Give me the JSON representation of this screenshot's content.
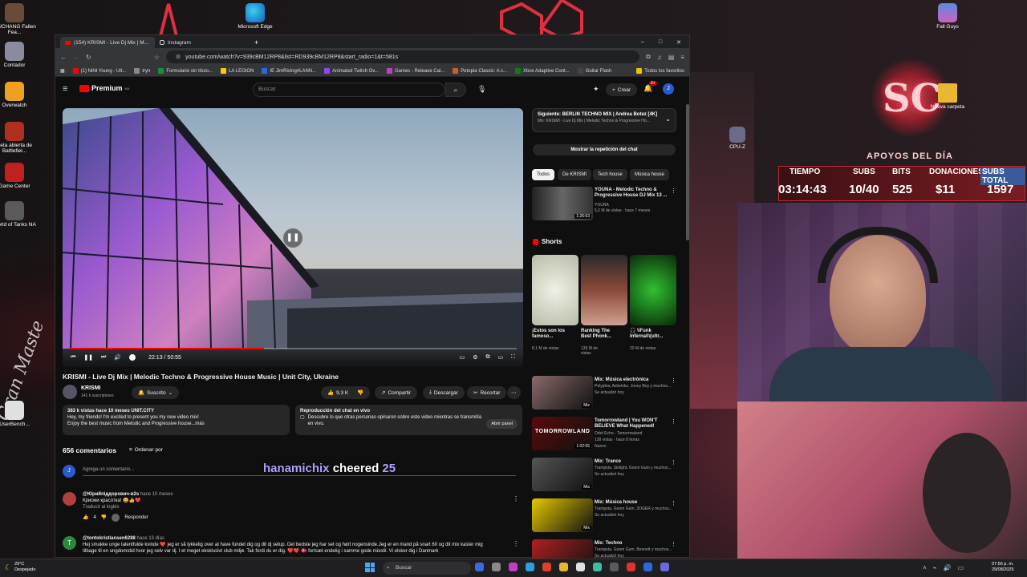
{
  "desktop": {
    "icons": [
      {
        "label": "WUCHANG Fallen Fea...",
        "color": "#6a4a3a"
      },
      {
        "label": "Contador",
        "color": "#8a8aa0"
      },
      {
        "label": "Overwatch",
        "color": "#f0a020"
      },
      {
        "label": "Beta abierta de Battlefiel...",
        "color": "#b03020"
      },
      {
        "label": "Game Center",
        "color": "#c02020"
      },
      {
        "label": "World of Tanks NA",
        "color": "#5a5a5a"
      },
      {
        "label": "UserBench...",
        "color": "#e0e0e0"
      }
    ],
    "edge": "Microsoft Edge",
    "fallguys": "Fall Guys",
    "folder": "Nueva carpeta",
    "cpu": "CPU-Z",
    "left_text": "Gran Maste"
  },
  "browser": {
    "tabs": [
      {
        "label": "(154) KRISMI - Live Dj Mix | M..."
      },
      {
        "label": "Instagram"
      }
    ],
    "new_tab": "+",
    "url": "youtube.com/watch?v=939cBM12RP8&list=RD939cBM12RP8&start_radio=1&t=581s",
    "bookmarks": [
      {
        "label": "(1) Nihil Young - Ult...",
        "color": "#ff0000"
      },
      {
        "label": "tryn",
        "color": "#888"
      },
      {
        "label": "Formulario sin título...",
        "color": "#1a8f3a"
      },
      {
        "label": "LA LEGION",
        "color": "#ffcc00"
      },
      {
        "label": "IE JimRising#LANN...",
        "color": "#2a6ae0"
      },
      {
        "label": "Animated Twitch Ov...",
        "color": "#9146ff"
      },
      {
        "label": "Games - Release Cal...",
        "color": "#c040c0"
      },
      {
        "label": "Petopia Classic: A c...",
        "color": "#d06020"
      },
      {
        "label": "Xbox Adaptive Cont...",
        "color": "#107c10"
      },
      {
        "label": "Guitar Flash",
        "color": "#444"
      },
      {
        "label": "Todos los favoritos",
        "color": "#f5c000"
      }
    ],
    "window_controls": [
      "–",
      "□",
      "✕"
    ]
  },
  "youtube": {
    "logo": "Premium",
    "logo_sup": "MX",
    "search_placeholder": "Buscar",
    "create": "Crear",
    "notif_count": "9+",
    "avatar": "J",
    "time": "22:13 / 50:55",
    "progress": 0.436,
    "title": "KRISMI - Live Dj Mix | Melodic Techno & Progressive House Music | Unit City, Ukraine",
    "channel": "KRISMI",
    "subs": "141 k suscriptores",
    "subscribed": "Suscrito",
    "likes": "9,3 K",
    "share": "Compartir",
    "download": "Descargar",
    "clip": "Recortar",
    "desc_meta": "383 k vistas  hace 10 meses  UNIT.CITY",
    "desc_line1": "Hey, my friends! I'm excited to present you my new video mix!",
    "desc_line2": "Enjoy the best music from Melodic and Progressive house...más",
    "chat_title": "Reproducción del chat en vivo",
    "chat_desc": "Descubre lo que otras personas opinaron sobre este video mientras se transmitía en vivo.",
    "chat_btn": "Abrir panel",
    "comments_count": "656 comentarios",
    "sort": "Ordenar por",
    "comment_placeholder": "Agrega un comentario...",
    "comments": [
      {
        "author": "@Юрийпіддорович-в2s",
        "ago": "hace 10 meses",
        "text": "Крисми красотка! 😃👍❤️",
        "translate": "Traducir al inglés",
        "likes": "4",
        "reply": "Responder",
        "color": "#b04040"
      },
      {
        "author": "@tontokristiansen6288",
        "ago": "hace 13 días",
        "text": "Hej smukke unge talentfulde kvinde ❤️ jeg er så lykkelig over at have fundet dig og dit dj setup. Det bedste jeg har set og hørt nogensinde.Jeg er en mand på snart 60 og dit mix kaster mig",
        "text2": "tilbage til en ungdomstid hvor jeg selv var dj. I et meget eksklusivt club miljø. Tak fordi du er dig. ❤️❤️ 🇩🇰 fortsæt endelig i samme gode mixstil. Vi elsker dig i Danmark",
        "color": "#2a8a3a",
        "avatar": "T"
      }
    ],
    "next_label": "Siguiente: BERLIN TECHNO MIX | Andrea Botez [4K]",
    "next_sub": "Mix: KRISMI - Live Dj Mix | Melodic Techno & Progressive Ho...",
    "show_chat": "Mostrar la repetición del chat",
    "chips": [
      "Todos",
      "De KRISMI",
      "Tech house",
      "Música house"
    ],
    "rec1": {
      "title": "YOUNA - Melodic Techno & Progressive House DJ Mix 13 ...",
      "channel": "YOUNA",
      "meta": "5,2 M de vistas · hace 7 meses",
      "duration": "1:26:53"
    },
    "shorts_label": "Shorts",
    "shorts": [
      {
        "title": "¡Estos son los famoso...",
        "views": "8,1 M de vistas",
        "color": "#d8dccf"
      },
      {
        "title": "Ranking The Best Phonk...",
        "views": "139 M de vistas",
        "color": "#6a3a30"
      },
      {
        "title": "🎧 \\\\Funk Infernal\\\\(ultr...",
        "views": "20 M de vistas",
        "color": "#0f3a10"
      }
    ],
    "mixes": [
      {
        "title": "Mix: Música electrónica",
        "meta": "Polyphia, Ashekiko, Jonny Boy y muchos...",
        "meta2": "Se actualizó hoy",
        "badge": "Mix",
        "color": "#8a6a6a"
      },
      {
        "title": "Tomorrowland | You WON'T BELIEVE What Happened!",
        "meta": "Orbit Echo - Tomorrowland",
        "meta2": "128 vistas · hace 8 horas",
        "meta3": "Nuevo",
        "badge": "1:02:55",
        "color": "#5a0a0a",
        "thumbtext": "TOMORROWLAND"
      },
      {
        "title": "Mix: Trance",
        "meta": "Trampsta, Sinlight, Goom Gum y muchos...",
        "meta2": "Se actualizó hoy",
        "badge": "Mix",
        "color": "#555"
      },
      {
        "title": "Mix: Música house",
        "meta": "Trampsta, Goom Gum, 3OGER y muchos...",
        "meta2": "Se actualizó hoy",
        "badge": "Mix",
        "color": "#e6c800"
      },
      {
        "title": "Mix: Techno",
        "meta": "Trampsta, Goom Gum, Bennett y muchos...",
        "meta2": "Se actualizó hoy",
        "badge": "",
        "color": "#b02020"
      }
    ]
  },
  "overlay": {
    "apoyos": "APOYOS DEL DÍA",
    "headers": [
      "TIEMPO",
      "SUBS",
      "BITS",
      "DONACIONES",
      "SUBS TOTAL"
    ],
    "values": [
      "03:14:43",
      "10/40",
      "525",
      "$11",
      "1597"
    ],
    "cheer_user": "hanamichix",
    "cheer_word": "cheered",
    "cheer_amount": "25",
    "logo": "SC"
  },
  "taskbar": {
    "weather_temp": "29°C",
    "weather_desc": "Despejado",
    "search": "Buscar",
    "time": "07:56 p. m.",
    "date": "29/08/2025"
  }
}
